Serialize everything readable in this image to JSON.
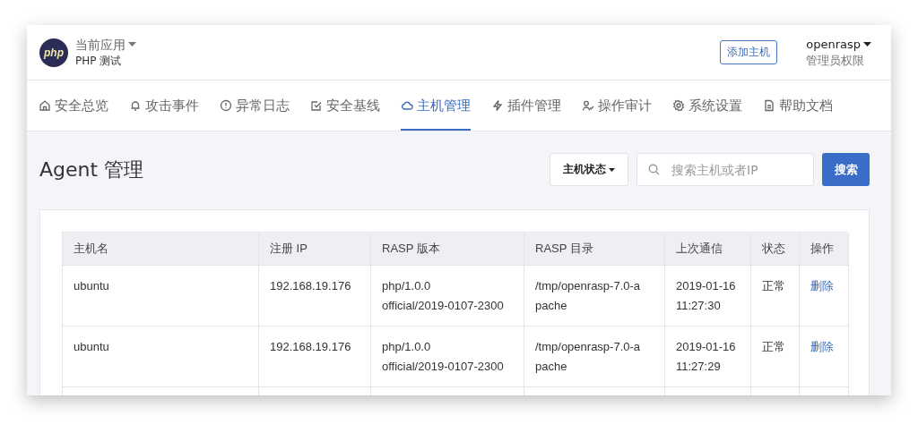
{
  "header": {
    "logo": "php",
    "app_menu": "当前应用",
    "app_name": "PHP 测试",
    "add_button": "添加主机",
    "user": "openrasp",
    "role": "管理员权限"
  },
  "tabs": [
    {
      "label": "安全总览",
      "selected": false
    },
    {
      "label": "攻击事件",
      "selected": false
    },
    {
      "label": "异常日志",
      "selected": false
    },
    {
      "label": "安全基线",
      "selected": false
    },
    {
      "label": "主机管理",
      "selected": true
    },
    {
      "label": "插件管理",
      "selected": false
    },
    {
      "label": "操作审计",
      "selected": false
    },
    {
      "label": "系统设置",
      "selected": false
    },
    {
      "label": "帮助文档",
      "selected": false
    }
  ],
  "page_title": "Agent 管理",
  "status_filter": "主机状态",
  "search": {
    "placeholder": "搜索主机或者IP",
    "button": "搜索"
  },
  "table": {
    "columns": [
      "主机名",
      "注册 IP",
      "RASP 版本",
      "RASP 目录",
      "上次通信",
      "状态",
      "操作"
    ],
    "rows": [
      {
        "cells": [
          "ubuntu",
          "192.168.19.176",
          "php/1.0.0 official/2019-0107-2300",
          "/tmp/openrasp-7.0-apache",
          "2019-01-16 11:27:30",
          "正常"
        ],
        "action": "删除"
      },
      {
        "cells": [
          "ubuntu",
          "192.168.19.176",
          "php/1.0.0 official/2019-0107-2300",
          "/tmp/openrasp-7.0-apache",
          "2019-01-16 11:27:29",
          "正常"
        ],
        "action": "删除"
      }
    ]
  }
}
